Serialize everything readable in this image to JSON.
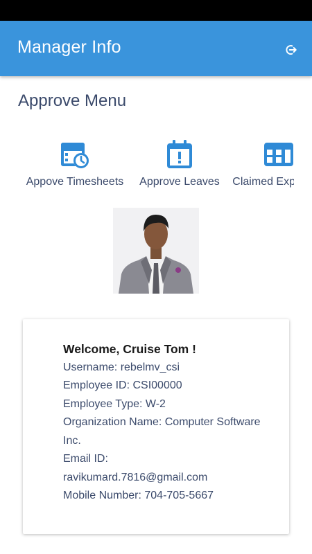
{
  "header": {
    "title": "Manager Info",
    "logout_icon": "logout-icon",
    "color": "#3a94dc"
  },
  "approve_menu": {
    "title": "Approve Menu",
    "items": [
      {
        "label": "Appove Timesheets",
        "icon": "timesheet-clock-icon"
      },
      {
        "label": "Approve Leaves",
        "icon": "calendar-alert-icon"
      },
      {
        "label": "Claimed Expenses",
        "icon": "expenses-icon"
      }
    ]
  },
  "profile": {
    "welcome": "Welcome, Cruise Tom !",
    "username": "Username: rebelmv_csi",
    "employee_id": "Employee ID: CSI00000",
    "employee_type": "Employee Type: W-2",
    "organization": "Organization Name: Computer Software Inc.",
    "email_label": "Email ID:",
    "email": "ravikumard.7816@gmail.com",
    "mobile": "Mobile Number: 704-705-5667"
  }
}
